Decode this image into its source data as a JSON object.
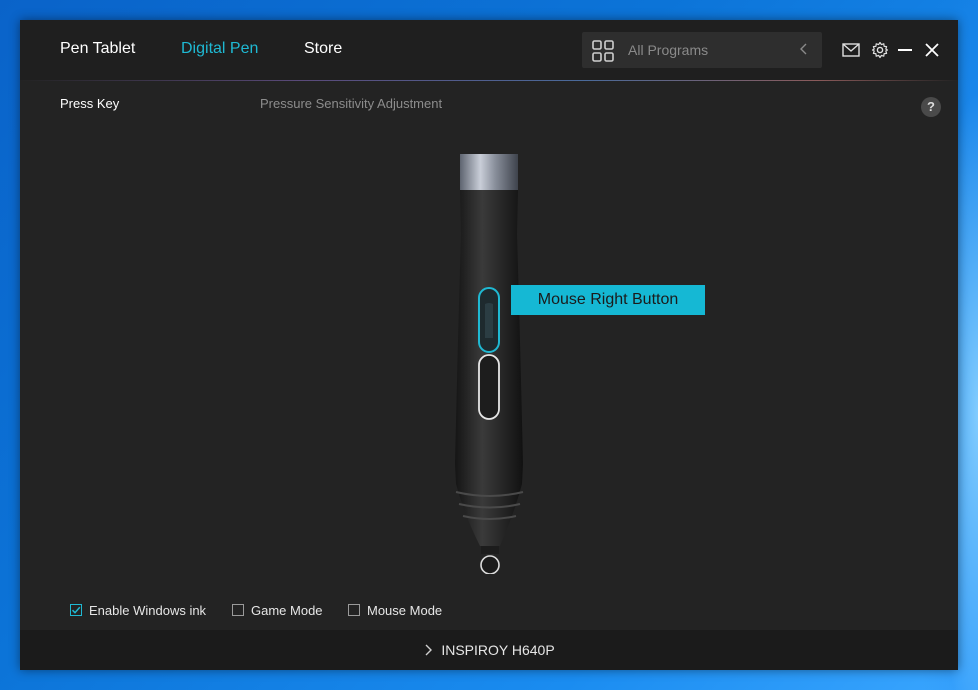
{
  "header": {
    "tabs": [
      {
        "label": "Pen Tablet",
        "active": false
      },
      {
        "label": "Digital Pen",
        "active": true
      },
      {
        "label": "Store",
        "active": false
      }
    ],
    "program_selector": {
      "label": "All Programs",
      "icon": "grid-icon"
    },
    "window_controls": [
      "mail-icon",
      "gear-icon",
      "minimize-icon",
      "close-icon"
    ]
  },
  "subtabs": [
    {
      "label": "Press Key",
      "active": true
    },
    {
      "label": "Pressure Sensitivity Adjustment",
      "active": false
    }
  ],
  "help_label": "?",
  "pen": {
    "selected_button_label": "Mouse Right Button"
  },
  "options": [
    {
      "label": "Enable Windows ink",
      "checked": true
    },
    {
      "label": "Game Mode",
      "checked": false
    },
    {
      "label": "Mouse Mode",
      "checked": false
    }
  ],
  "device": {
    "name": "INSPIROY H640P"
  },
  "colors": {
    "accent": "#1fb9d3",
    "background": "#232323"
  }
}
